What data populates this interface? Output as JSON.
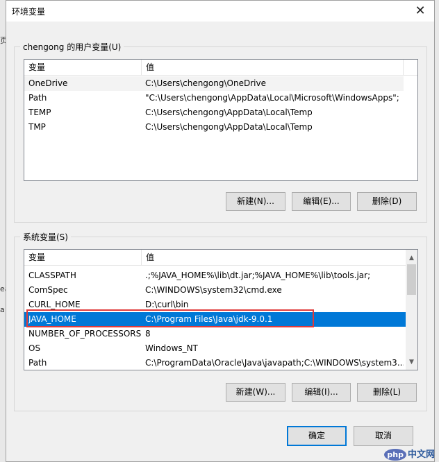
{
  "window": {
    "title": "环境变量",
    "close_glyph": "✕"
  },
  "background_fragments": [
    "页",
    "ea",
    "a"
  ],
  "user_vars": {
    "group_label": "chengong 的用户变量(U)",
    "columns": [
      "变量",
      "值"
    ],
    "rows": [
      {
        "name": "OneDrive",
        "value": "C:\\Users\\chengong\\OneDrive"
      },
      {
        "name": "Path",
        "value": "\"C:\\Users\\chengong\\AppData\\Local\\Microsoft\\WindowsApps\";"
      },
      {
        "name": "TEMP",
        "value": "C:\\Users\\chengong\\AppData\\Local\\Temp"
      },
      {
        "name": "TMP",
        "value": "C:\\Users\\chengong\\AppData\\Local\\Temp"
      }
    ],
    "buttons": {
      "new": "新建(N)...",
      "edit": "编辑(E)...",
      "delete": "删除(D)"
    }
  },
  "system_vars": {
    "group_label": "系统变量(S)",
    "columns": [
      "变量",
      "值"
    ],
    "rows": [
      {
        "name": "CLASSPATH",
        "value": ".;%JAVA_HOME%\\lib\\dt.jar;%JAVA_HOME%\\lib\\tools.jar;"
      },
      {
        "name": "ComSpec",
        "value": "C:\\WINDOWS\\system32\\cmd.exe"
      },
      {
        "name": "CURL_HOME",
        "value": "D:\\curl\\bin"
      },
      {
        "name": "JAVA_HOME",
        "value": "C:\\Program Files\\Java\\jdk-9.0.1"
      },
      {
        "name": "NUMBER_OF_PROCESSORS",
        "value": "8"
      },
      {
        "name": "OS",
        "value": "Windows_NT"
      },
      {
        "name": "Path",
        "value": "C:\\ProgramData\\Oracle\\Java\\javapath;C:\\WINDOWS\\system3..."
      }
    ],
    "selected_index": 3,
    "buttons": {
      "new": "新建(W)...",
      "edit": "编辑(I)...",
      "delete": "删除(L)"
    }
  },
  "dialog_buttons": {
    "ok": "确定",
    "cancel": "取消"
  },
  "watermark": {
    "logo": "php",
    "text": "中文网"
  },
  "colors": {
    "selection": "#0078d7",
    "highlight_box": "#e03a3a",
    "default_button_border": "#0078d7"
  }
}
